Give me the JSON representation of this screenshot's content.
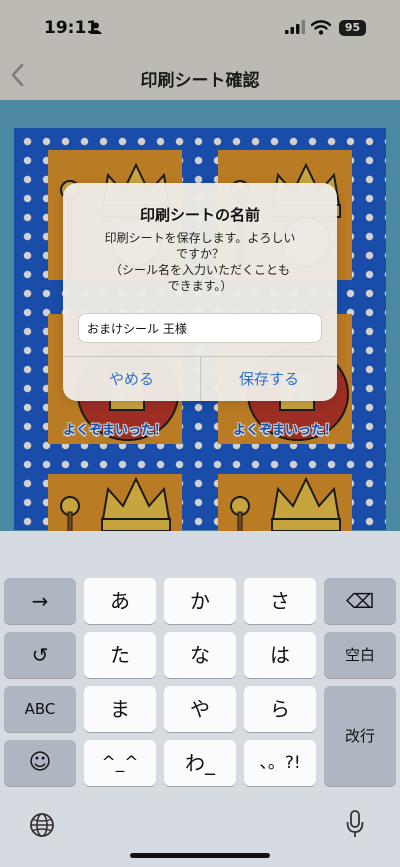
{
  "status_bar": {
    "time": "19:11",
    "battery": "95"
  },
  "nav": {
    "title": "印刷シート確認"
  },
  "sheet": {
    "captions": [
      "よくぞまいった！",
      "よくぞまいった！"
    ]
  },
  "dialog": {
    "title": "印刷シートの名前",
    "message_lines": [
      "印刷シートを保存します。よろしい",
      "ですか？",
      "（シール名を入力いただくことも",
      "できます。）"
    ],
    "input_value": "おまけシール 王様",
    "cancel_label": "やめる",
    "save_label": "保存する"
  },
  "keyboard": {
    "row1": [
      "→",
      "あ",
      "か",
      "さ",
      "⌫"
    ],
    "row2": [
      "↺",
      "た",
      "な",
      "は",
      "空白"
    ],
    "row3": [
      "ABC",
      "ま",
      "や",
      "ら",
      "改行"
    ],
    "row4": [
      "☺",
      "^_^",
      "わ_",
      "、。?!"
    ],
    "colors": {
      "key": "#fbfbfb",
      "fn_key": "#aeb6c2",
      "background": "#d6dbe2"
    }
  },
  "colors": {
    "accent": "#2f6fd8",
    "sheet_blue": "#1f5fcf",
    "card_orange": "#e2962b",
    "background": "#5fa7c6"
  }
}
